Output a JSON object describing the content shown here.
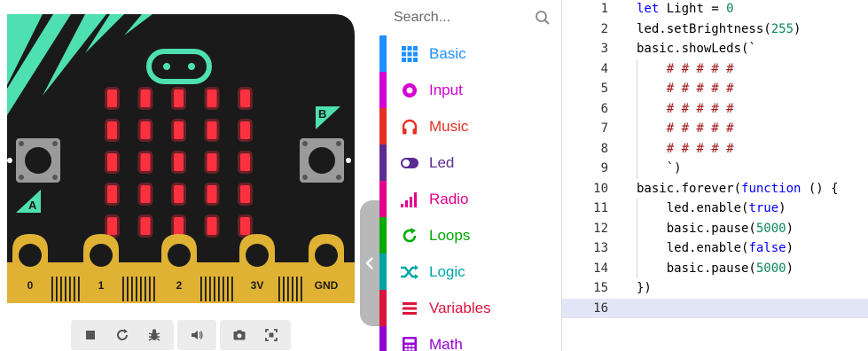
{
  "simulator": {
    "pins": [
      "0",
      "1",
      "2",
      "3V",
      "GND"
    ],
    "button_a": "A",
    "button_b": "B",
    "led_rows": 5,
    "led_cols": 5,
    "leds_on": [
      [
        1,
        1,
        1,
        1,
        1
      ],
      [
        1,
        1,
        1,
        1,
        1
      ],
      [
        1,
        1,
        1,
        1,
        1
      ],
      [
        1,
        1,
        1,
        1,
        1
      ],
      [
        1,
        1,
        1,
        1,
        1
      ]
    ],
    "toolbar": {
      "stop_icon": "stop-icon",
      "restart_icon": "restart-icon",
      "debug_icon": "bug-icon",
      "mute_icon": "speaker-icon",
      "screenshot_icon": "camera-icon",
      "fullscreen_icon": "fullscreen-icon"
    },
    "colors": {
      "board": "#1a1a1a",
      "accent": "#4ee0b0",
      "led_on": "#ff3040",
      "pin_gold": "#e0b234"
    }
  },
  "toolbox": {
    "search_placeholder": "Search...",
    "categories": [
      {
        "label": "Basic",
        "color": "#1e90ff",
        "icon": "grid-icon"
      },
      {
        "label": "Input",
        "color": "#d400d4",
        "icon": "circle-icon"
      },
      {
        "label": "Music",
        "color": "#e63022",
        "icon": "headphones-icon"
      },
      {
        "label": "Led",
        "color": "#5c2d91",
        "icon": "toggle-icon"
      },
      {
        "label": "Radio",
        "color": "#e3008c",
        "icon": "signal-icon"
      },
      {
        "label": "Loops",
        "color": "#00aa00",
        "icon": "refresh-icon"
      },
      {
        "label": "Logic",
        "color": "#00a4a6",
        "icon": "shuffle-icon"
      },
      {
        "label": "Variables",
        "color": "#dc143c",
        "icon": "list-icon"
      },
      {
        "label": "Math",
        "color": "#9400d3",
        "icon": "calculator-icon"
      }
    ]
  },
  "editor": {
    "lines": [
      {
        "n": "1",
        "text": "let Light = 0"
      },
      {
        "n": "2",
        "text": "led.setBrightness(255)"
      },
      {
        "n": "3",
        "text": "basic.showLeds(`"
      },
      {
        "n": "4",
        "text": "    # # # # #"
      },
      {
        "n": "5",
        "text": "    # # # # #"
      },
      {
        "n": "6",
        "text": "    # # # # #"
      },
      {
        "n": "7",
        "text": "    # # # # #"
      },
      {
        "n": "8",
        "text": "    # # # # #"
      },
      {
        "n": "9",
        "text": "    `)"
      },
      {
        "n": "10",
        "text": "basic.forever(function () {"
      },
      {
        "n": "11",
        "text": "    led.enable(true)"
      },
      {
        "n": "12",
        "text": "    basic.pause(5000)"
      },
      {
        "n": "13",
        "text": "    led.enable(false)"
      },
      {
        "n": "14",
        "text": "    basic.pause(5000)"
      },
      {
        "n": "15",
        "text": "})"
      },
      {
        "n": "16",
        "text": ""
      }
    ],
    "active_line": "16"
  }
}
